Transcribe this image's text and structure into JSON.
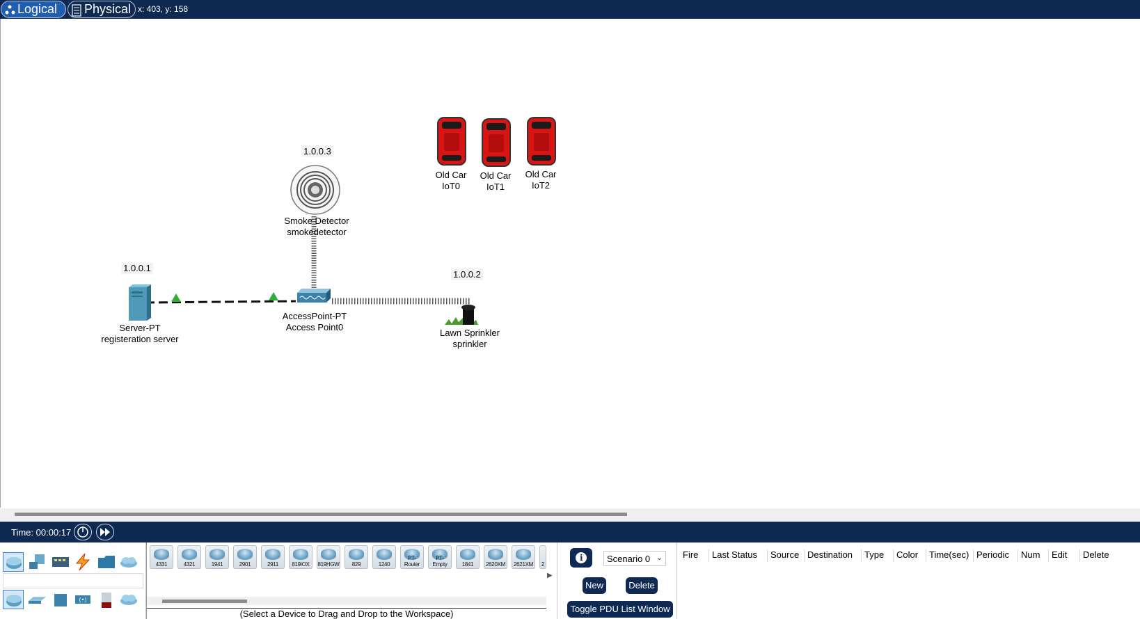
{
  "topbar": {
    "logical_label": "Logical",
    "physical_label": "Physical",
    "coordinates": "x: 403, y: 158"
  },
  "workspace": {
    "devices": [
      {
        "name": "Server-PT",
        "label": "registeration server",
        "ip": "1.0.0.1"
      },
      {
        "name": "AccessPoint-PT",
        "label": "Access Point0",
        "ip": ""
      },
      {
        "name": "Smoke Detector",
        "label": "smokedetector",
        "ip": "1.0.0.3"
      },
      {
        "name": "Lawn Sprinkler",
        "label": "sprinkler",
        "ip": "1.0.0.2"
      },
      {
        "name": "Old Car",
        "label": "IoT0",
        "ip": ""
      },
      {
        "name": "Old Car",
        "label": "IoT1",
        "ip": ""
      },
      {
        "name": "Old Car",
        "label": "IoT2",
        "ip": ""
      }
    ]
  },
  "statusbar": {
    "time": "Time: 00:00:17"
  },
  "device_panel": {
    "tiles": [
      "4331",
      "4321",
      "1941",
      "2901",
      "2911",
      "819IOX",
      "819HGW",
      "829",
      "1240",
      "PT-Router",
      "PT-Empty",
      "1841",
      "2620XM",
      "2621XM",
      "2"
    ],
    "hint": "(Select a Device to Drag and Drop to the Workspace)"
  },
  "pdu": {
    "scenario": "Scenario 0",
    "new_label": "New",
    "delete_label": "Delete",
    "toggle_label": "Toggle PDU List Window",
    "columns": [
      "Fire",
      "Last Status",
      "Source",
      "Destination",
      "Type",
      "Color",
      "Time(sec)",
      "Periodic",
      "Num",
      "Edit",
      "Delete"
    ]
  },
  "colors": {
    "chrome": "#0e2a52",
    "link_ok": "#2fae3a",
    "car_red": "#d81414"
  }
}
